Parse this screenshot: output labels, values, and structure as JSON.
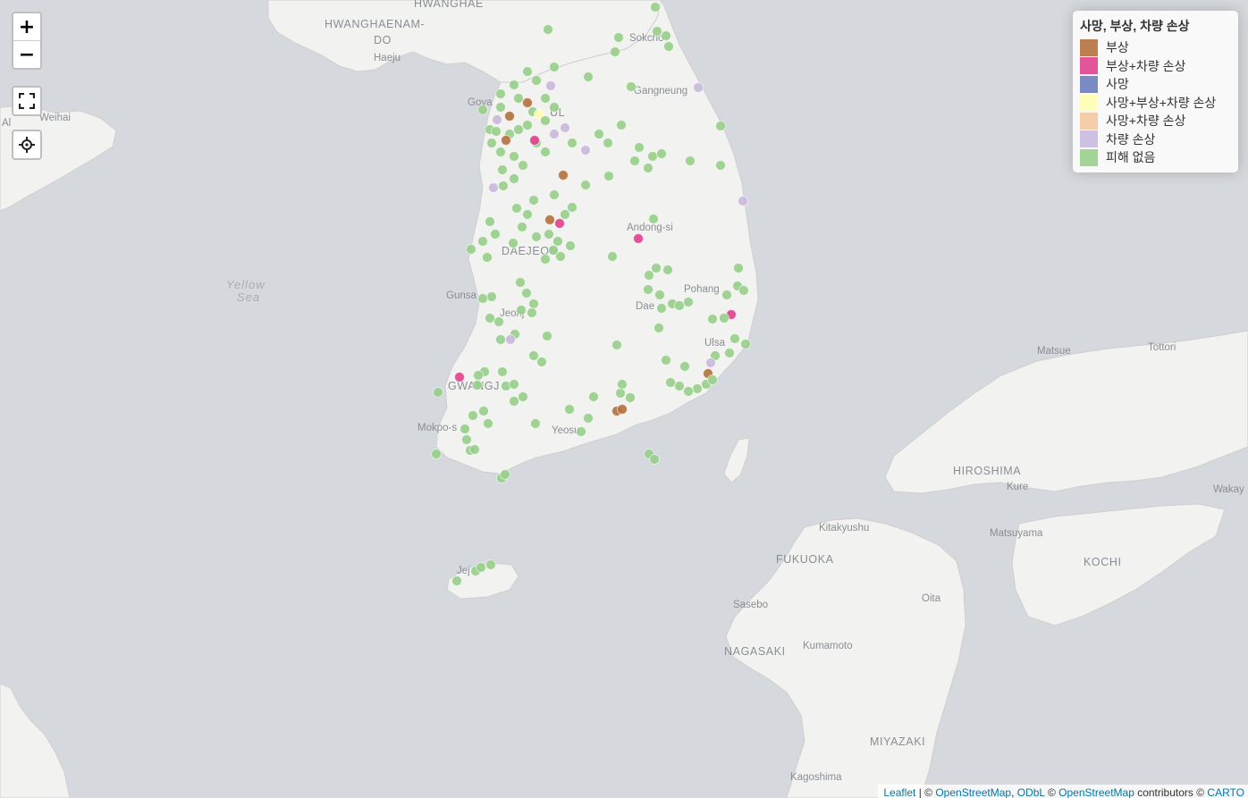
{
  "map": {
    "controls": {
      "zoom_in_label": "+",
      "zoom_out_label": "−"
    },
    "legend": {
      "title": "사망, 부상, 차량 손상",
      "items": [
        {
          "label": "부상",
          "color": "#b5713c"
        },
        {
          "label": "부상+차량 손상",
          "color": "#e0418e"
        },
        {
          "label": "사망",
          "color": "#6d7fbf"
        },
        {
          "label": "사망+부상+차량 손상",
          "color": "#ffffb3"
        },
        {
          "label": "사망+차량 손상",
          "color": "#f4c8a0"
        },
        {
          "label": "차량 손상",
          "color": "#c9b9dd"
        },
        {
          "label": "피해 없음",
          "color": "#98cf8a"
        }
      ]
    },
    "place_labels": [
      {
        "text": "HWANGHAE",
        "kind": "major"
      },
      {
        "text": "HWANGHAENAM-",
        "kind": "major"
      },
      {
        "text": "DO",
        "kind": "major"
      },
      {
        "text": "Haeju",
        "kind": "city"
      },
      {
        "text": "Sokcho",
        "kind": "city"
      },
      {
        "text": "Weihai",
        "kind": "city"
      },
      {
        "text": "Gangneung",
        "kind": "city"
      },
      {
        "text": "Goya",
        "kind": "city"
      },
      {
        "text": "UL",
        "kind": "major"
      },
      {
        "text": "Yellow",
        "kind": "sea"
      },
      {
        "text": "Sea",
        "kind": "sea"
      },
      {
        "text": "Andong-si",
        "kind": "city"
      },
      {
        "text": "DAEJEON",
        "kind": "major"
      },
      {
        "text": "Gunsa",
        "kind": "city"
      },
      {
        "text": "Pohang",
        "kind": "city"
      },
      {
        "text": "Jeonj",
        "kind": "city"
      },
      {
        "text": "Dae",
        "kind": "city"
      },
      {
        "text": "Ulsa",
        "kind": "city"
      },
      {
        "text": "Matsue",
        "kind": "city"
      },
      {
        "text": "Tottori",
        "kind": "city"
      },
      {
        "text": "GWANGJ",
        "kind": "major"
      },
      {
        "text": "Mokpo-s",
        "kind": "city"
      },
      {
        "text": "Yeosu",
        "kind": "city"
      },
      {
        "text": "HIROSHIMA",
        "kind": "major"
      },
      {
        "text": "Kure",
        "kind": "city"
      },
      {
        "text": "Wakay",
        "kind": "city"
      },
      {
        "text": "Kitakyushu",
        "kind": "city"
      },
      {
        "text": "Matsuyama",
        "kind": "city"
      },
      {
        "text": "FUKUOKA",
        "kind": "major"
      },
      {
        "text": "KOCHI",
        "kind": "major"
      },
      {
        "text": "Jej",
        "kind": "city"
      },
      {
        "text": "Oita",
        "kind": "city"
      },
      {
        "text": "Sasebo",
        "kind": "city"
      },
      {
        "text": "Kumamoto",
        "kind": "city"
      },
      {
        "text": "NAGASAKI",
        "kind": "major"
      },
      {
        "text": "MIYAZAKI",
        "kind": "major"
      },
      {
        "text": "Kagoshima",
        "kind": "city"
      },
      {
        "text": "Al",
        "kind": "city"
      }
    ],
    "attribution": {
      "leaflet": "Leaflet",
      "sep1": " | © ",
      "osm": "OpenStreetMap",
      "sep2": ", ",
      "odbl": "ODbL",
      "sep3": " © ",
      "osm2": "OpenStreetMap",
      "contributors": " contributors © ",
      "carto": "CARTO"
    }
  }
}
